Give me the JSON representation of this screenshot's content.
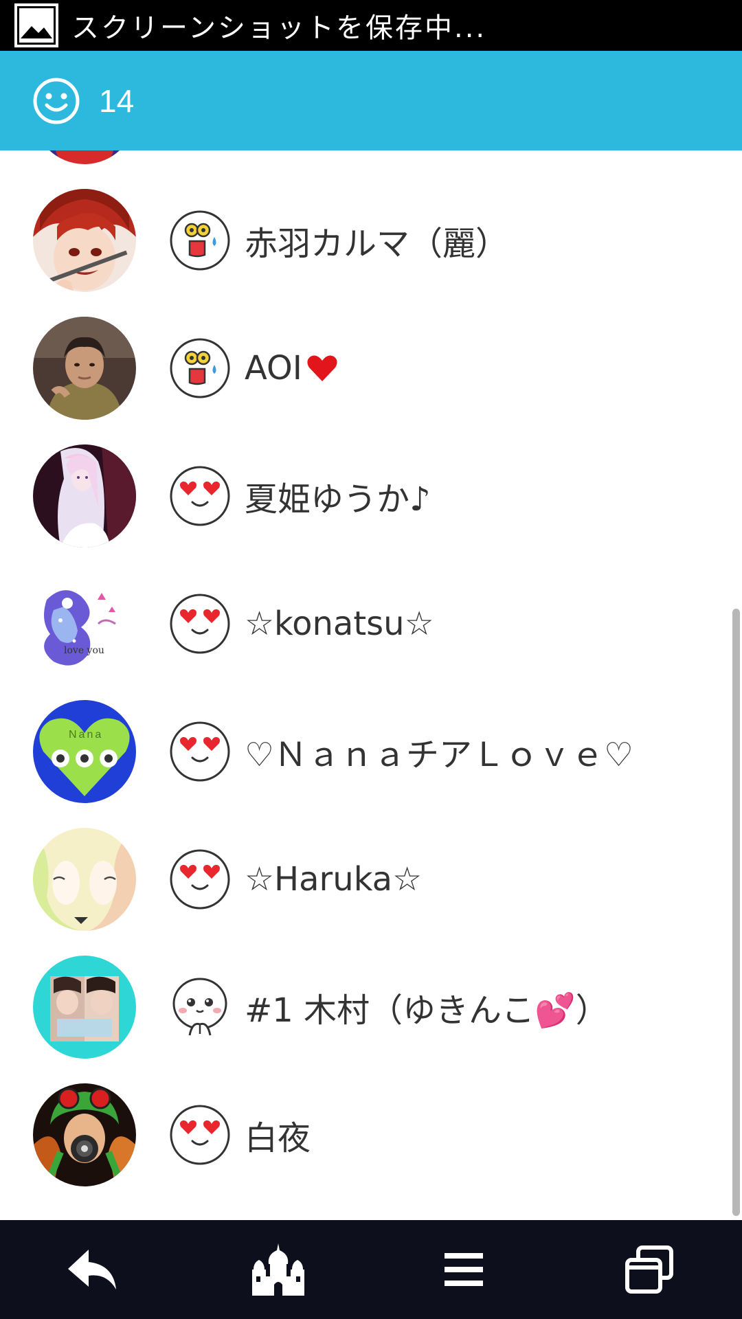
{
  "status_bar": {
    "notification_text": "スクリーンショットを保存中...",
    "icon": "picture-icon"
  },
  "header": {
    "icon": "smiley-icon",
    "count": "14",
    "accent_color": "#2db8de"
  },
  "list": {
    "items": [
      {
        "name": "赤羽カルマ（麗）",
        "mood": "scared-face-icon",
        "avatar": "red-hair-anime-avatar"
      },
      {
        "name": "AOI",
        "mood": "scared-face-icon",
        "avatar": "man-photo-avatar",
        "suffix_icon": "red-heart-icon"
      },
      {
        "name": "夏姫ゆうか♪",
        "mood": "heart-eyes-face-icon",
        "avatar": "ice-princess-avatar"
      },
      {
        "name": "☆konatsu☆",
        "mood": "heart-eyes-face-icon",
        "avatar": "galaxy-silhouette-avatar"
      },
      {
        "name": "♡ＮａｎａチアＬｏｖｅ♡",
        "mood": "heart-eyes-face-icon",
        "avatar": "green-heart-avatar"
      },
      {
        "name": "☆Haruka☆",
        "mood": "heart-eyes-face-icon",
        "avatar": "two-anime-girls-avatar"
      },
      {
        "name": "#1 木村（ゆきんこ💕）",
        "mood": "pleading-face-icon",
        "avatar": "couple-photo-avatar"
      },
      {
        "name": "白夜",
        "mood": "heart-eyes-face-icon",
        "avatar": "gas-mask-anime-avatar"
      }
    ]
  },
  "bottom_nav": {
    "buttons": [
      {
        "icon": "reply-arrow-icon"
      },
      {
        "icon": "castle-icon"
      },
      {
        "icon": "hamburger-menu-icon"
      },
      {
        "icon": "stacked-windows-icon"
      }
    ]
  }
}
